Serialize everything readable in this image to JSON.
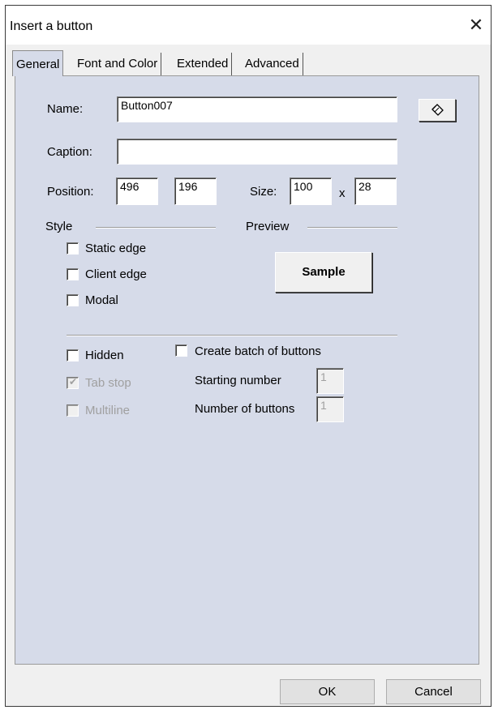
{
  "window": {
    "title": "Insert a button",
    "close_glyph": "✕"
  },
  "tabs": [
    {
      "label": "General",
      "active": true
    },
    {
      "label": "Font and Color",
      "active": false
    },
    {
      "label": "Extended",
      "active": false
    },
    {
      "label": "Advanced",
      "active": false
    }
  ],
  "general": {
    "name_label": "Name:",
    "name_value": "Button007",
    "pick_icon": "eraser-icon",
    "caption_label": "Caption:",
    "caption_value": "",
    "position_label": "Position:",
    "position_x": "496",
    "position_y": "196",
    "size_label": "Size:",
    "size_w": "100",
    "size_x_sep": "x",
    "size_h": "28",
    "style_label": "Style",
    "preview_label": "Preview",
    "static_edge_label": "Static edge",
    "client_edge_label": "Client edge",
    "modal_label": "Modal",
    "sample_label": "Sample",
    "hidden_label": "Hidden",
    "tab_stop_label": "Tab stop",
    "multiline_label": "Multiline",
    "batch_label": "Create batch of buttons",
    "starting_number_label": "Starting number",
    "starting_number_value": "1",
    "number_of_buttons_label": "Number of buttons",
    "number_of_buttons_value": "1"
  },
  "footer": {
    "ok_label": "OK",
    "cancel_label": "Cancel"
  }
}
